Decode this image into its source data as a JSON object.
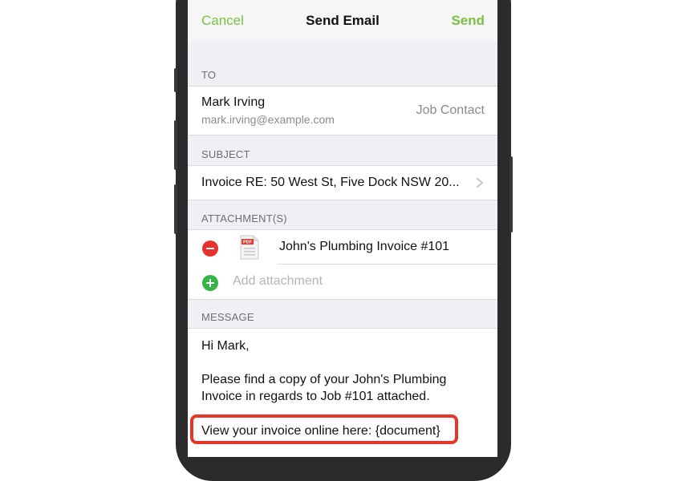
{
  "navbar": {
    "cancel_label": "Cancel",
    "title": "Send Email",
    "send_label": "Send",
    "accent_color": "#7ac142"
  },
  "to": {
    "section_label": "TO",
    "name": "Mark Irving",
    "email": "mark.irving@example.com",
    "role": "Job Contact"
  },
  "subject": {
    "section_label": "SUBJECT",
    "value": "Invoice RE: 50 West St, Five Dock NSW 20..."
  },
  "attachments": {
    "section_label": "ATTACHMENT(S)",
    "items": [
      {
        "name": "John's Plumbing Invoice #101",
        "icon": "pdf-file-icon",
        "icon_badge": "PDF"
      }
    ],
    "add_label": "Add attachment"
  },
  "message": {
    "section_label": "MESSAGE",
    "greeting": "Hi Mark,",
    "body_line1": "Please find a copy of your John's Plumbing",
    "body_line2": "Invoice in regards to Job #101 attached.",
    "view_online": "View your invoice online here: {document}",
    "highlight_color": "#e8352a"
  }
}
